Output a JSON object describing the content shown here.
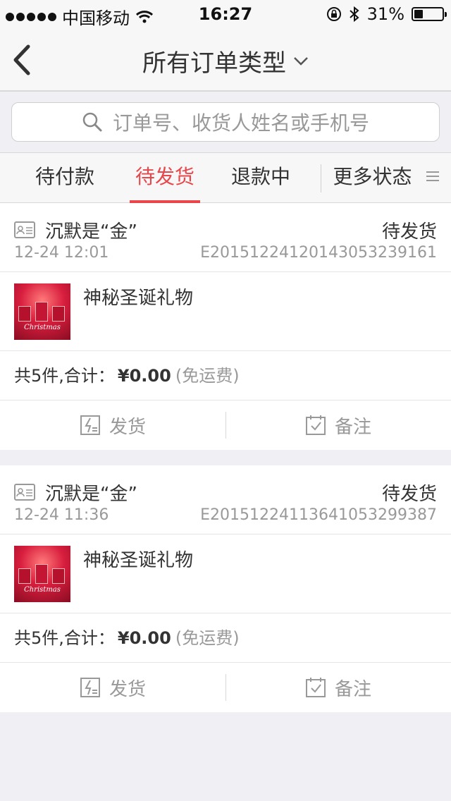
{
  "status_bar": {
    "carrier": "中国移动",
    "time": "16:27",
    "battery_percent": "31%",
    "battery_level": 0.31
  },
  "nav": {
    "title": "所有订单类型"
  },
  "search": {
    "placeholder": "订单号、收货人姓名或手机号"
  },
  "tabs": [
    {
      "label": "待付款",
      "active": false
    },
    {
      "label": "待发货",
      "active": true
    },
    {
      "label": "退款中",
      "active": false
    },
    {
      "label": "更多状态",
      "active": false
    }
  ],
  "colors": {
    "accent": "#e8464a",
    "background": "#efeff4"
  },
  "orders": [
    {
      "buyer": "沉默是“金”",
      "status": "待发货",
      "time": "12-24 12:01",
      "order_no": "E20151224120143053239161",
      "product_name": "神秘圣诞礼物",
      "thumb_text": "Christmas",
      "summary_prefix": "共5件,合计：",
      "amount": "¥0.00",
      "shipping_note": "(免运费)",
      "action_ship": "发货",
      "action_note": "备注"
    },
    {
      "buyer": "沉默是“金”",
      "status": "待发货",
      "time": "12-24 11:36",
      "order_no": "E20151224113641053299387",
      "product_name": "神秘圣诞礼物",
      "thumb_text": "Christmas",
      "summary_prefix": "共5件,合计：",
      "amount": "¥0.00",
      "shipping_note": "(免运费)",
      "action_ship": "发货",
      "action_note": "备注"
    }
  ]
}
